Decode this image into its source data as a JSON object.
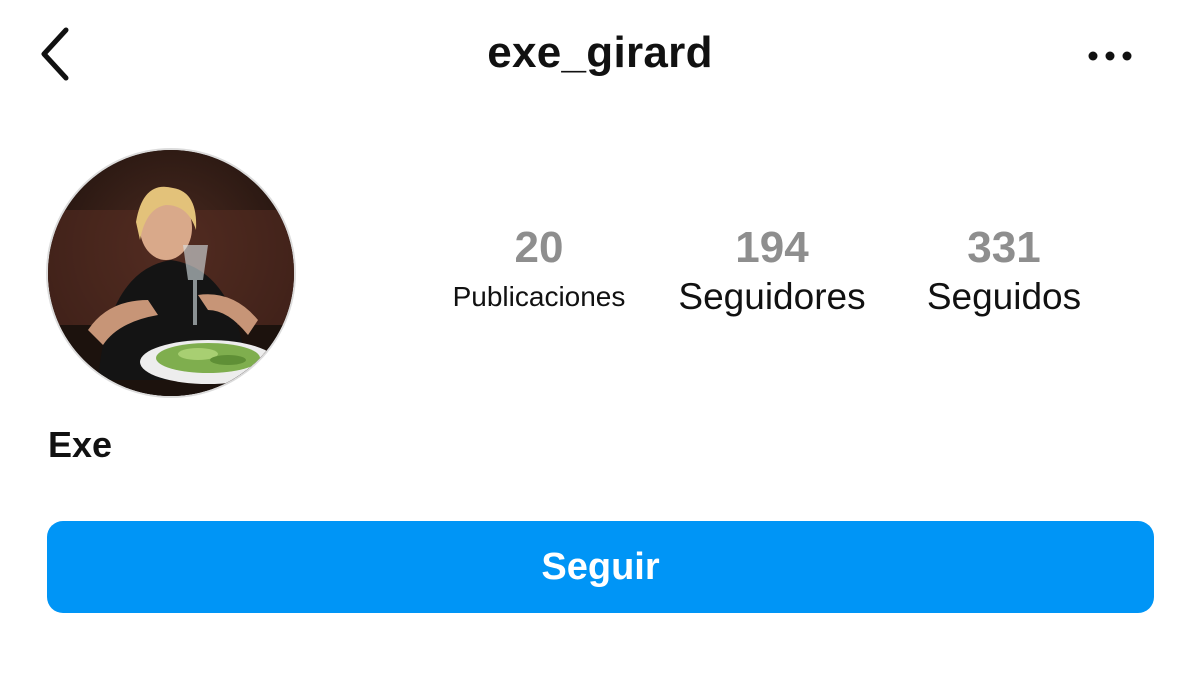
{
  "header": {
    "username": "exe_girard",
    "back_icon": "chevron-left-icon",
    "more_icon": "more-horizontal-icon"
  },
  "profile": {
    "display_name": "Exe",
    "avatar": "profile-photo"
  },
  "stats": {
    "posts": {
      "value": "20",
      "label": "Publicaciones"
    },
    "followers": {
      "value": "194",
      "label": "Seguidores"
    },
    "following": {
      "value": "331",
      "label": "Seguidos"
    }
  },
  "actions": {
    "follow_label": "Seguir"
  },
  "colors": {
    "accent": "#0095f6",
    "stat_number": "#8e8e8e",
    "text": "#111111",
    "background": "#ffffff"
  }
}
